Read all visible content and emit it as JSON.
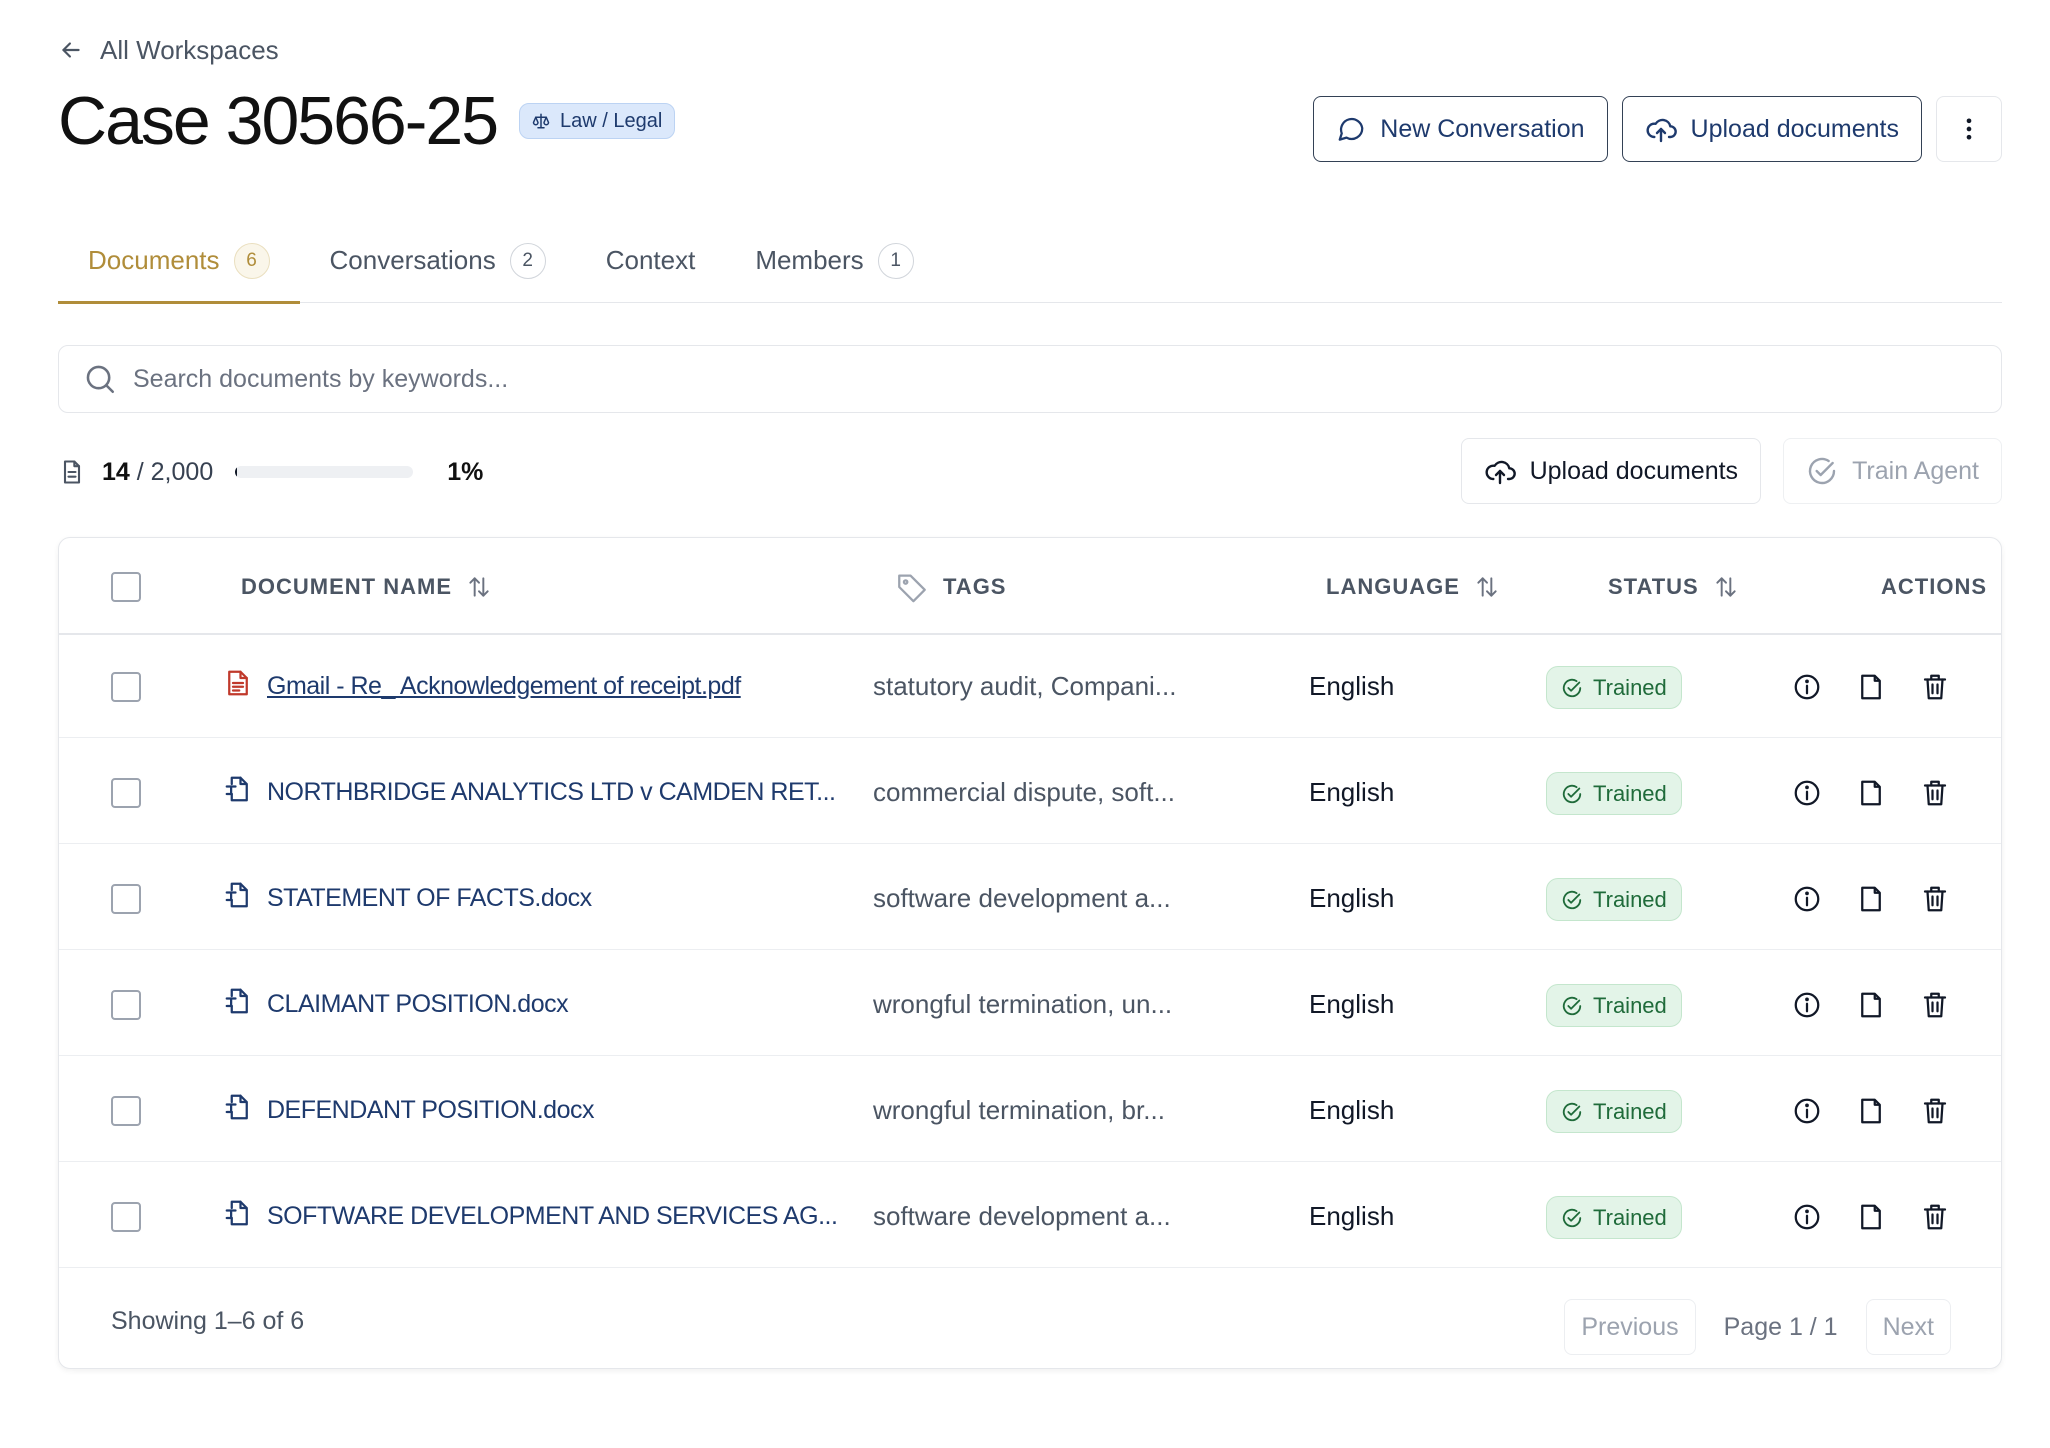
{
  "nav": {
    "back_label": "All Workspaces"
  },
  "workspace": {
    "title": "Case 30566-25",
    "category": "Law / Legal"
  },
  "header_actions": {
    "new_conversation": "New Conversation",
    "upload_documents": "Upload documents"
  },
  "tabs": [
    {
      "label": "Documents",
      "count": "6"
    },
    {
      "label": "Conversations",
      "count": "2"
    },
    {
      "label": "Context",
      "count": ""
    },
    {
      "label": "Members",
      "count": "1"
    }
  ],
  "search": {
    "placeholder": "Search documents by keywords..."
  },
  "usage": {
    "used": "14",
    "limit": "2,000",
    "percent_label": "1%",
    "fraction": 0.01
  },
  "toolbar": {
    "upload_documents": "Upload documents",
    "train_agent": "Train Agent"
  },
  "table": {
    "columns": {
      "name": "DOCUMENT NAME",
      "tags": "TAGS",
      "language": "LANGUAGE",
      "status": "STATUS",
      "actions": "ACTIONS"
    },
    "rows": [
      {
        "name": "Gmail - Re_ Acknowledgement of receipt.pdf",
        "type": "pdf",
        "tags": "statutory audit, Compani...",
        "language": "English",
        "status": "Trained"
      },
      {
        "name": "NORTHBRIDGE ANALYTICS LTD v CAMDEN RET...",
        "type": "docx",
        "tags": "commercial dispute, soft...",
        "language": "English",
        "status": "Trained"
      },
      {
        "name": "STATEMENT OF FACTS.docx",
        "type": "docx",
        "tags": "software development a...",
        "language": "English",
        "status": "Trained"
      },
      {
        "name": "CLAIMANT POSITION.docx",
        "type": "docx",
        "tags": "wrongful termination, un...",
        "language": "English",
        "status": "Trained"
      },
      {
        "name": "DEFENDANT POSITION.docx",
        "type": "docx",
        "tags": "wrongful termination, br...",
        "language": "English",
        "status": "Trained"
      },
      {
        "name": "SOFTWARE DEVELOPMENT AND SERVICES AG...",
        "type": "docx",
        "tags": "software development a...",
        "language": "English",
        "status": "Trained"
      }
    ]
  },
  "footer": {
    "showing": "Showing 1–6 of 6",
    "previous": "Previous",
    "page_info": "Page 1 / 1",
    "next": "Next"
  },
  "colors": {
    "accent_gold": "#b08d3a",
    "link_navy": "#1e3a6d",
    "status_green": "#1f6b3a",
    "pdf_red": "#c0392b"
  }
}
